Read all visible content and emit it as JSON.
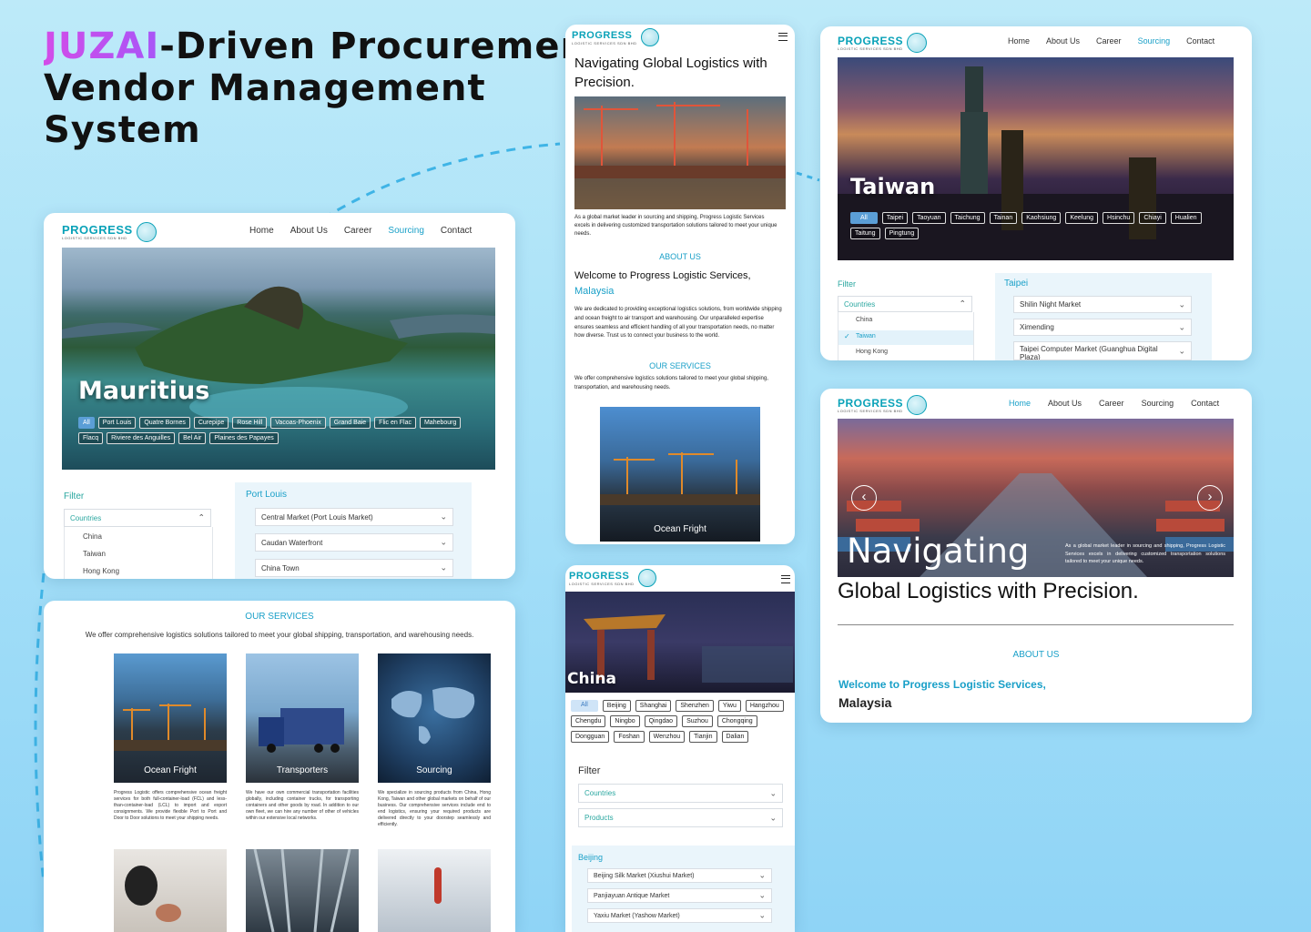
{
  "headline": {
    "accent": "JUZAI",
    "line1_rest": "-Driven Procurement",
    "line2": "Vendor Management",
    "line3": "System"
  },
  "brand": {
    "name": "PROGRESS",
    "sub": "LOGISTIC SERVICES SDN BHD"
  },
  "nav": {
    "home": "Home",
    "about": "About Us",
    "career": "Career",
    "sourcing": "Sourcing",
    "contact": "Contact"
  },
  "mauritius": {
    "title": "Mauritius",
    "chips": [
      "All",
      "Port Louis",
      "Quatre Bornes",
      "Curepipe",
      "Rose Hill",
      "Vacoas-Phoenix",
      "Grand Baie",
      "Flic en Flac",
      "Mahebourg",
      "Flacq",
      "Riviere des Anguilles",
      "Bel Air",
      "Plaines des Papayes"
    ],
    "filter": "Filter",
    "countries": "Countries",
    "country_list": [
      "China",
      "Taiwan",
      "Hong Kong"
    ],
    "city": "Port Louis",
    "markets": [
      "Central Market (Port Louis Market)",
      "Caudan Waterfront",
      "China Town"
    ]
  },
  "services": {
    "heading": "OUR SERVICES",
    "intro": "We offer comprehensive logistics solutions tailored to meet your global shipping, transportation, and warehousing needs.",
    "items": [
      {
        "label": "Ocean Fright",
        "text": "Progress Logistic offers comprehensive ocean freight services for both full-container-load (FCL) and less-than-container-load (LCL) to import and export consignments. We provide flexible Port to Port and Door to Door solutions to meet your shipping needs."
      },
      {
        "label": "Transporters",
        "text": "We have our own commercial transportation facilities globally, including container trucks, for transporting containers and other goods by road. In addition to our own fleet, we can hire any number of other of vehicles within our extensive local networks."
      },
      {
        "label": "Sourcing",
        "text": "We specialize in sourcing products from China, Hong Kong, Taiwan and other global markets on behalf of our business. Our comprehensive services include end to end logistics, ensuring your required products are delivered directly to your doorstep seamlessly and efficiently."
      }
    ]
  },
  "mobile1": {
    "title": "Navigating Global Logistics with Precision.",
    "intro": "As a global market leader in sourcing and shipping, Progress Logistic Services excels in delivering customized transportation solutions tailored to meet your unique needs.",
    "about_heading": "ABOUT US",
    "welcome": "Welcome to Progress Logistic Services,",
    "welcome_accent": "Malaysia",
    "about_text": "We are dedicated to providing exceptional logistics solutions, from worldwide shipping and ocean freight to air transport and warehousing. Our unparalleled expertise ensures seamless and efficient handling of all your transportation needs, no matter how diverse. Trust us to connect your business to the world.",
    "services_heading": "OUR SERVICES",
    "services_text": "We offer comprehensive logistics solutions tailored to meet your global shipping, transportation, and warehousing needs.",
    "card_label": "Ocean Fright"
  },
  "china": {
    "title": "China",
    "chips": [
      "All",
      "Beijing",
      "Shanghai",
      "Shenzhen",
      "Yiwu",
      "Hangzhou",
      "Chengdu",
      "Ningbo",
      "Qingdao",
      "Suzhou",
      "Chongqing",
      "Dongguan",
      "Foshan",
      "Wenzhou",
      "Tianjin",
      "Dalian"
    ],
    "filter": "Filter",
    "countries": "Countries",
    "products": "Products",
    "city": "Beijing",
    "markets": [
      "Beijing Silk Market (Xiushui Market)",
      "Panjiayuan Antique Market",
      "Yaxiu Market (Yashow Market)"
    ]
  },
  "taiwan": {
    "title": "Taiwan",
    "chips": [
      "All",
      "Taipei",
      "Taoyuan",
      "Taichung",
      "Tainan",
      "Kaohsiung",
      "Keelung",
      "Hsinchu",
      "Chiayi",
      "Hualien",
      "Taitung",
      "Pingtung"
    ],
    "filter": "Filter",
    "countries": "Countries",
    "country_list": [
      "China",
      "Taiwan",
      "Hong Kong"
    ],
    "city": "Taipei",
    "markets": [
      "Shilin Night Market",
      "Ximending",
      "Taipei Computer Market (Guanghua Digital Plaza)"
    ]
  },
  "home": {
    "big": "Navigating",
    "rest": "Global Logistics with Precision.",
    "blurb": "As a global market leader in sourcing and shipping, Progress Logistic Services excels in delivering customized transportation solutions tailored to meet your unique needs.",
    "about_heading": "ABOUT US",
    "welcome": "Welcome to Progress Logistic Services,",
    "country": "Malaysia"
  },
  "icons": [
    "globe-icon",
    "menu-icon",
    "chevron-down-icon",
    "chevron-up-icon",
    "check-icon",
    "arrow-left-icon",
    "arrow-right-icon"
  ],
  "colors": {
    "brand": "#0aa2b8",
    "accent": "#1aa0c8",
    "filter": "#2aa7a0",
    "background": "#a6e0f8"
  }
}
